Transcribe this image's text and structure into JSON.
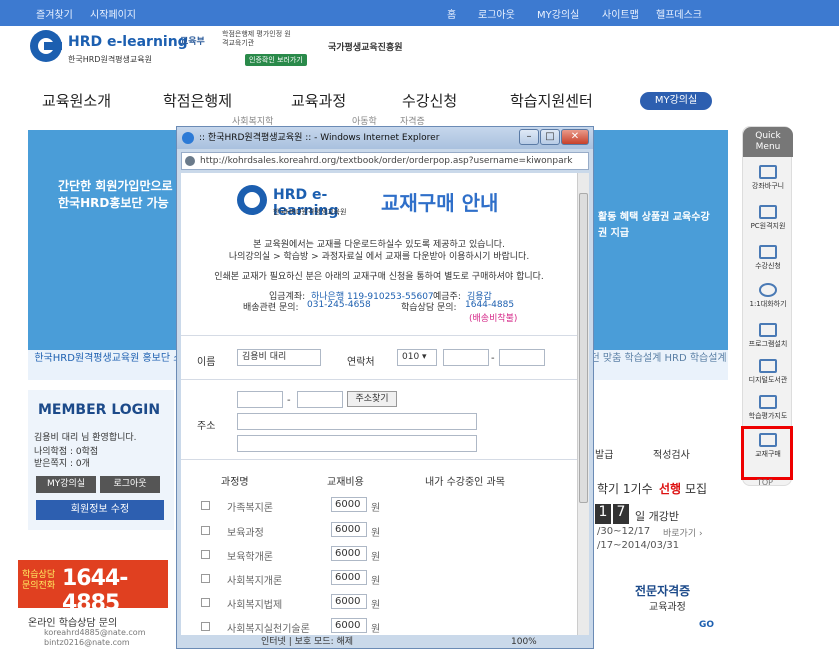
{
  "topbar": {
    "left": [
      "즐겨찾기",
      "시작페이지"
    ],
    "right": [
      "홈",
      "로그아웃",
      "MY강의실",
      "사이트맵",
      "헬프데스크"
    ]
  },
  "logo": {
    "name": "HRD e-learning",
    "sub": "한국HRD원격평생교육원"
  },
  "partners": {
    "p1": "교육부",
    "p2": "학점은행제 평가인정 원격교육기관",
    "p3": "인증확인 보러가기",
    "p4": "국가평생교육진흥원"
  },
  "nav": {
    "items": [
      "교육원소개",
      "학점은행제",
      "교육과정",
      "수강신청",
      "학습지원센터"
    ],
    "my": "MY강의실",
    "sub": [
      "사회복지학",
      "아동학",
      "자격증"
    ]
  },
  "banner": {
    "text": "간단한 회원가입만으로 한국HRD홍보단 가능",
    "left_caption": "한국HRD원격평생교육원 홍보단 소개",
    "right_caption": "없던 맞춤 학습설계 HRD 학습설계",
    "side_text": "활동 혜택 상품권 교육수강권 지급"
  },
  "login": {
    "title": "MEMBER LOGIN",
    "welcome": "김용비 대리 님 환영합니다.",
    "credits": "나의학점 : 0학점",
    "notes": "받은쪽지 : 0개",
    "my_btn": "MY강의실",
    "logout_btn": "로그아웃",
    "edit_btn": "회원정보 수정"
  },
  "phone": {
    "label": "학습상담 문의전화",
    "number": "1644-4885"
  },
  "online": {
    "title": "온라인 학습상담 문의",
    "email1": "koreahrd4885@nate.com",
    "email2": "bintz0216@nate.com"
  },
  "quick": {
    "title": "Quick Menu",
    "items": [
      "강좌바구니",
      "PC원격지원",
      "수강신청",
      "1:1대화하기",
      "프로그램설치",
      "디지털도서관",
      "학습평가지도",
      "교재구매"
    ],
    "top": "TOP"
  },
  "right_section": {
    "exam": "적성검사",
    "issue": "발급",
    "semester": "학기 1기수",
    "recruit": "선행",
    "recruit2": "모집",
    "num1": "1",
    "num2": "7",
    "start": "일 개강반",
    "date1": "/30~12/17",
    "link": "바로가기 ›",
    "date2": "/17~2014/03/31",
    "cert": "전문자격증",
    "cert2": "교육과정",
    "go": "GO"
  },
  "popup": {
    "title": ":: 한국HRD원격평생교육원 :: - Windows Internet Explorer",
    "url": "http://kohrdsales.koreahrd.org/textbook/order/orderpop.asp?username=kiwonpark",
    "heading": "교재구매 안내",
    "logo_name": "HRD e-learning",
    "logo_sub": "한국HRD원격평생교육원",
    "intro1": "본 교육원에서는 교재를 다운로드하실수 있도록 제공하고 있습니다.",
    "intro2": "나의강의실 > 학습방 > 과정자료실 에서 교재를 다운받아 이용하시기 바랍니다.",
    "intro3": "인쇄본 교재가 필요하신 분은 아래의 교재구매 신청을 통하여 별도로 구매하셔야 합니다.",
    "bank_label": "입금계좌:",
    "bank": "하나은행 119-910253-55607",
    "holder_label": "예금주:",
    "holder": "김용갑",
    "ship_label": "배송관련 문의:",
    "ship": "031-245-4658",
    "study_label": "학습상담 문의:",
    "study": "1644-4885",
    "ship_note": "(배송비착불)",
    "name_label": "이름",
    "name_value": "김용비 대리",
    "contact_label": "연락처",
    "phone_prefix": "010",
    "dash": "-",
    "addr_label": "주소",
    "addr_btn": "주소찾기",
    "col_course": "과정명",
    "col_price": "교재비용",
    "col_mine": "내가 수강중인 과목",
    "courses": [
      {
        "name": "가족복지론",
        "price": "6000",
        "unit": "원"
      },
      {
        "name": "보육과정",
        "price": "6000",
        "unit": "원"
      },
      {
        "name": "보육학개론",
        "price": "6000",
        "unit": "원"
      },
      {
        "name": "사회복지개론",
        "price": "6000",
        "unit": "원"
      },
      {
        "name": "사회복지법제",
        "price": "6000",
        "unit": "원"
      },
      {
        "name": "사회복지실천기술론",
        "price": "6000",
        "unit": "원"
      }
    ],
    "status": "인터넷 | 보호 모드: 해제",
    "zoom": "100%"
  }
}
